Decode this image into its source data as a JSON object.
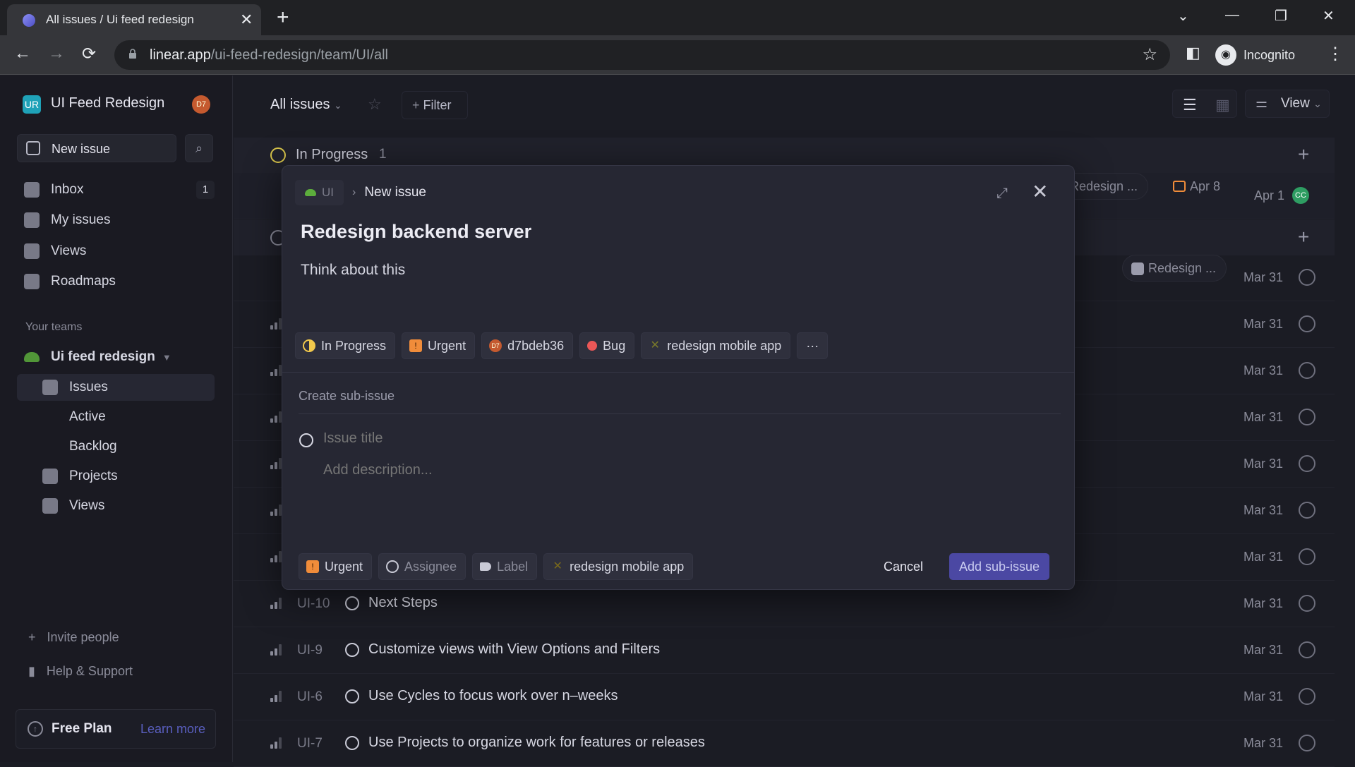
{
  "browser": {
    "tab_title": "All issues / Ui feed redesign",
    "url_host": "linear.app",
    "url_path": "/ui-feed-redesign/team/UI/all",
    "profile_label": "Incognito"
  },
  "sidebar": {
    "workspace_initials": "UR",
    "workspace_name": "UI Feed Redesign",
    "user_avatar": "D7",
    "new_issue_label": "New issue",
    "items": [
      {
        "label": "Inbox",
        "count": "1"
      },
      {
        "label": "My issues"
      },
      {
        "label": "Views"
      },
      {
        "label": "Roadmaps"
      }
    ],
    "teams_header": "Your teams",
    "team_name": "Ui feed redesign",
    "team_items": [
      {
        "label": "Issues"
      },
      {
        "label": "Active"
      },
      {
        "label": "Backlog"
      },
      {
        "label": "Projects"
      },
      {
        "label": "Views"
      }
    ],
    "invite_label": "Invite people",
    "help_label": "Help & Support",
    "plan_label": "Free Plan",
    "learn_more": "Learn more"
  },
  "header": {
    "title": "All issues",
    "filter_label": "Filter",
    "view_label": "View"
  },
  "groups": [
    {
      "label": "In Progress",
      "count": "1"
    }
  ],
  "bg_row_meta": {
    "project_chip": "Redesign ...",
    "due_date": "Apr 8",
    "date": "Apr 1",
    "assignee": "CC",
    "second_project_chip": "Redesign ..."
  },
  "rows": [
    {
      "date": "Mar 31"
    },
    {
      "date": "Mar 31"
    },
    {
      "date": "Mar 31"
    },
    {
      "date": "Mar 31"
    },
    {
      "date": "Mar 31"
    },
    {
      "date": "Mar 31"
    },
    {
      "date": "Mar 31"
    },
    {
      "id": "UI-10",
      "title": "Next Steps",
      "date": "Mar 31"
    },
    {
      "id": "UI-9",
      "title": "Customize views with View Options and Filters",
      "date": "Mar 31"
    },
    {
      "id": "UI-6",
      "title": "Use Cycles to focus work over n–weeks",
      "date": "Mar 31"
    },
    {
      "id": "UI-7",
      "title": "Use Projects to organize work for features or releases",
      "date": "Mar 31"
    }
  ],
  "modal": {
    "team": "UI",
    "crumb": "New issue",
    "title": "Redesign backend server",
    "description": "Think about this",
    "props": {
      "status": "In Progress",
      "priority": "Urgent",
      "assignee": "d7bdeb36",
      "assignee_initials": "D7",
      "label": "Bug",
      "project": "redesign mobile app",
      "more": "···"
    },
    "sub_header": "Create sub-issue",
    "sub_title_placeholder": "Issue title",
    "sub_desc_placeholder": "Add description...",
    "sub_props": {
      "priority": "Urgent",
      "assignee": "Assignee",
      "label": "Label",
      "project": "redesign mobile app"
    },
    "cancel_label": "Cancel",
    "submit_label": "Add sub-issue"
  },
  "colors": {
    "accent": "#4b48a3",
    "urgent": "#f08c3a",
    "bug": "#eb5757",
    "in_progress": "#f2c94c",
    "team": "#5cad3c"
  }
}
